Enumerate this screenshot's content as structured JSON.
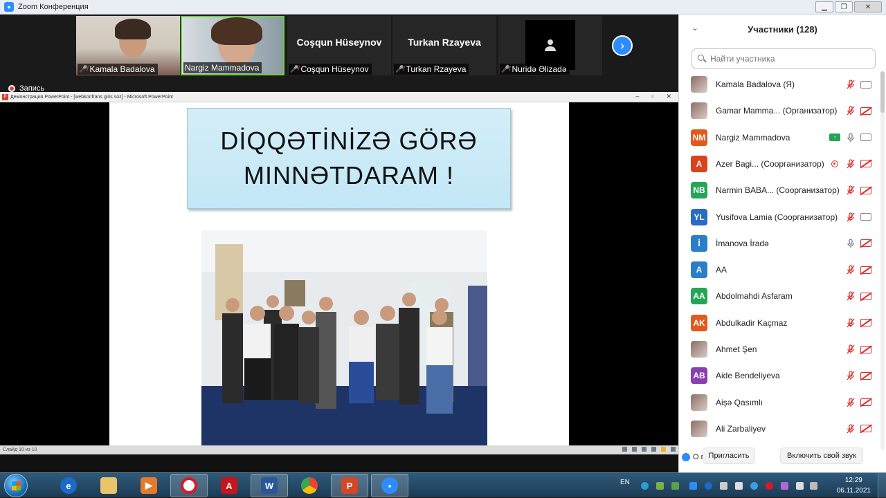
{
  "window": {
    "title": "Zoom Конференция",
    "controls": [
      "minimize",
      "maximize",
      "close"
    ]
  },
  "video_strip": {
    "tiles": [
      {
        "name": "Kamala Badalova",
        "type": "video",
        "muted": true
      },
      {
        "name": "Nargiz Mammadova",
        "type": "video",
        "muted": false,
        "active": true
      },
      {
        "name": "Coşqun Hüseynov",
        "type": "name",
        "muted": true
      },
      {
        "name": "Turkan Rzayeva",
        "type": "name",
        "muted": true
      },
      {
        "name": "Nuridə Əlizadə",
        "type": "avatar",
        "muted": true
      }
    ],
    "recording_label": "Запись"
  },
  "powerpoint": {
    "window_title": "Демонстрация PowerPoint - [webkonfrans giris soz] - Microsoft PowerPoint",
    "slide_title": "DİQQƏTİNİZƏ GÖRƏ\nMINNƏTDARAM    !",
    "status_text": "Слайд 10 из 10"
  },
  "participants": {
    "header": "Участники (128)",
    "search_placeholder": "Найти участника",
    "list": [
      {
        "name": "Kamala Badalova (Я)",
        "avatar": "",
        "color": "",
        "photo": true,
        "mic": "off",
        "video": "on"
      },
      {
        "name": "Gamar Mamma... (Организатор)",
        "avatar": "",
        "color": "",
        "photo": true,
        "mic": "off",
        "video": "off"
      },
      {
        "name": "Nargiz Mammadova",
        "avatar": "NM",
        "color": "#e05a1e",
        "mic": "on",
        "video": "on",
        "share": true
      },
      {
        "name": "Azer Bagi...  (Соорганизатор)",
        "avatar": "A",
        "color": "#d9441f",
        "mic": "off",
        "video": "off",
        "rec": true
      },
      {
        "name": "Narmin BABA... (Соорганизатор)",
        "avatar": "NB",
        "color": "#25a556",
        "mic": "off",
        "video": "off"
      },
      {
        "name": "Yusifova Lamia (Соорганизатор)",
        "avatar": "YL",
        "color": "#2a6cc2",
        "mic": "off",
        "video": "on"
      },
      {
        "name": "İmanova İradə",
        "avatar": "İ",
        "color": "#2a7fc8",
        "mic": "on",
        "video": "off"
      },
      {
        "name": "AA",
        "avatar": "A",
        "color": "#2a7fc8",
        "mic": "off",
        "video": "off"
      },
      {
        "name": "Abdolmahdi Asfaram",
        "avatar": "AA",
        "color": "#25a556",
        "mic": "off",
        "video": "off"
      },
      {
        "name": "Abdulkadir Kaçmaz",
        "avatar": "AK",
        "color": "#e05a1e",
        "mic": "off",
        "video": "off"
      },
      {
        "name": "Ahmet Şen",
        "avatar": "",
        "color": "",
        "photo": true,
        "mic": "off",
        "video": "off"
      },
      {
        "name": "Aide Bendeliyeva",
        "avatar": "AB",
        "color": "#8a3fb0",
        "mic": "off",
        "video": "off"
      },
      {
        "name": "Aişə Qasımlı",
        "avatar": "",
        "color": "",
        "photo": true,
        "mic": "off",
        "video": "off"
      },
      {
        "name": "Ali Zarbaliyev",
        "avatar": "",
        "color": "",
        "photo": true,
        "mic": "off",
        "video": "off"
      }
    ],
    "invite_label": "Пригласить",
    "unmute_label": "Включить свой звук",
    "tooltip": "О програм"
  },
  "taskbar": {
    "apps": [
      "start",
      "ie",
      "explorer",
      "media-player",
      "opera",
      "acrobat",
      "word",
      "chrome",
      "powerpoint",
      "zoom"
    ],
    "language": "EN",
    "time": "12:29",
    "date": "06.11.2021"
  }
}
